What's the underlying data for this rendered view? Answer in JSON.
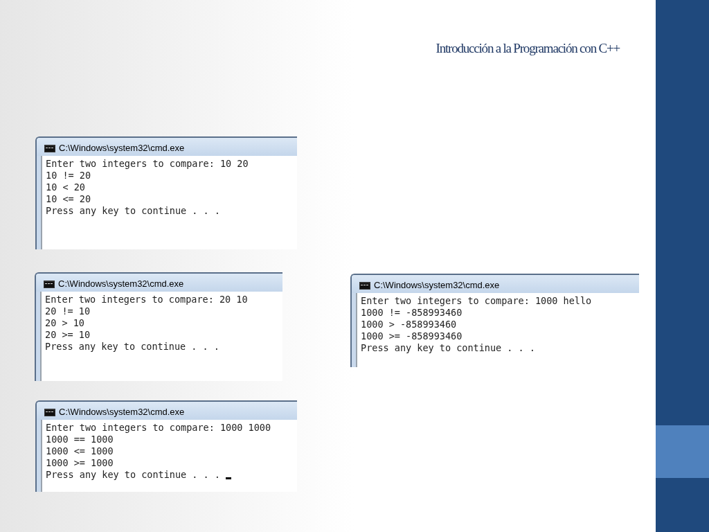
{
  "slide": {
    "title": "Introducción a la Programación con C++"
  },
  "windows": [
    {
      "title": "C:\\Windows\\system32\\cmd.exe",
      "lines": [
        "Enter two integers to compare: 10 20",
        "10 != 20",
        "10 < 20",
        "10 <= 20",
        "Press any key to continue . . ."
      ],
      "cursor": false
    },
    {
      "title": "C:\\Windows\\system32\\cmd.exe",
      "lines": [
        "Enter two integers to compare: 20 10",
        "20 != 10",
        "20 > 10",
        "20 >= 10",
        "Press any key to continue . . ."
      ],
      "cursor": false
    },
    {
      "title": "C:\\Windows\\system32\\cmd.exe",
      "lines": [
        "Enter two integers to compare: 1000 hello",
        "1000 != -858993460",
        "1000 > -858993460",
        "1000 >= -858993460",
        "Press any key to continue . . ."
      ],
      "cursor": false
    },
    {
      "title": "C:\\Windows\\system32\\cmd.exe",
      "lines": [
        "Enter two integers to compare: 1000 1000",
        "1000 == 1000",
        "1000 <= 1000",
        "1000 >= 1000",
        "Press any key to continue . . ."
      ],
      "cursor": true
    }
  ]
}
